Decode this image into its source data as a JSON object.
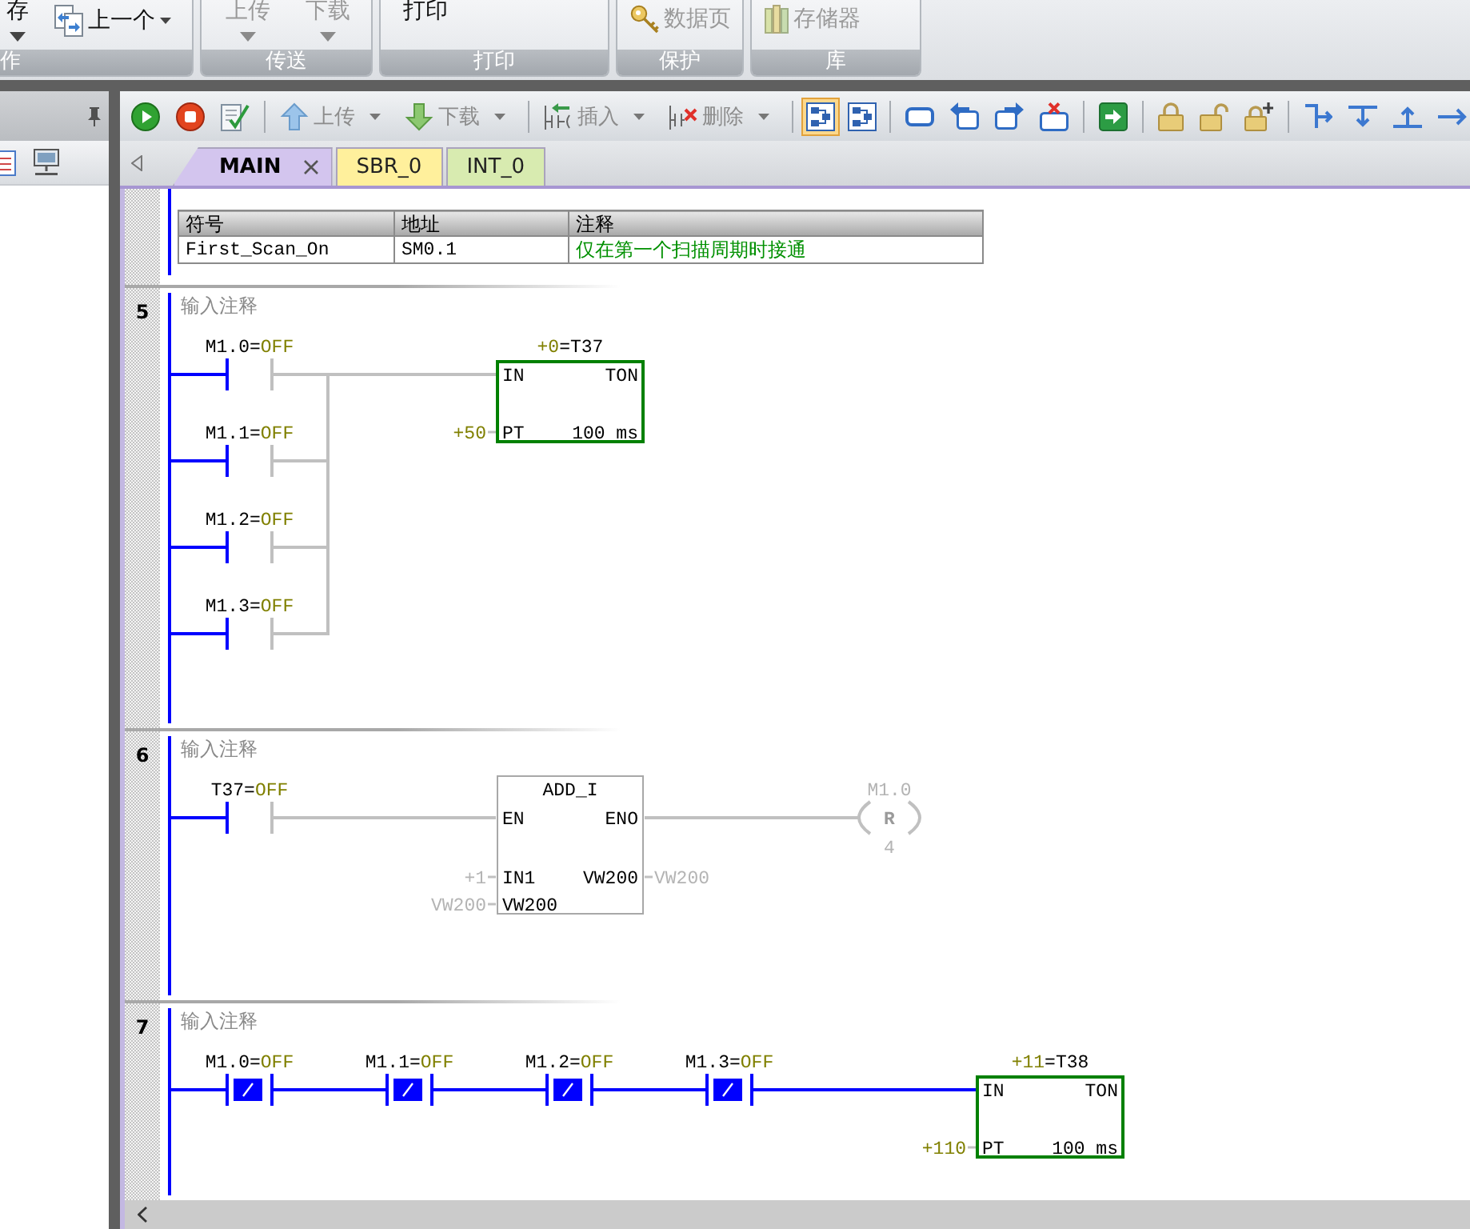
{
  "ribbon": {
    "groups": [
      {
        "label": "作",
        "buttons": [
          {
            "label": "存",
            "kind": "dropdown",
            "disabled": false
          },
          {
            "label": "上一个",
            "kind": "iconmenu",
            "disabled": false
          }
        ]
      },
      {
        "label": "传送",
        "buttons": [
          {
            "label": "上传",
            "kind": "dropdown",
            "disabled": true
          },
          {
            "label": "下载",
            "kind": "dropdown",
            "disabled": true
          }
        ]
      },
      {
        "label": "打印",
        "buttons": [
          {
            "label": "打印",
            "kind": "text",
            "disabled": false
          }
        ]
      },
      {
        "label": "保护",
        "buttons": [
          {
            "label": "数据页",
            "kind": "icon",
            "disabled": true
          }
        ]
      },
      {
        "label": "库",
        "buttons": [
          {
            "label": "存储器",
            "kind": "icon",
            "disabled": true
          }
        ]
      }
    ]
  },
  "toolbar": {
    "buttons": [
      {
        "label": "上传",
        "disabled": true
      },
      {
        "label": "下载",
        "disabled": true
      },
      {
        "label": "插入",
        "disabled": true
      },
      {
        "label": "删除",
        "disabled": true
      }
    ],
    "view_toggles": [
      {
        "selected": true
      },
      {
        "selected": false
      }
    ]
  },
  "tabs": [
    {
      "label": "MAIN",
      "selected": true,
      "color": "#d3c5ee"
    },
    {
      "label": "SBR_0",
      "selected": false,
      "color": "#fff09c"
    },
    {
      "label": "INT_0",
      "selected": false,
      "color": "#d8ebb0"
    }
  ],
  "symbol_table": {
    "columns": [
      "符号",
      "地址",
      "注释"
    ],
    "rows": [
      [
        "First_Scan_On",
        "SM0.1",
        "仅在第一个扫描周期时接通"
      ]
    ]
  },
  "networks": [
    {
      "number": "5",
      "comment": "输入注释",
      "branches": [
        {
          "label": "M1.0=",
          "value": "OFF",
          "kind": "no",
          "closed": false
        },
        {
          "label": "M1.1=",
          "value": "OFF",
          "kind": "no",
          "closed": false
        },
        {
          "label": "M1.2=",
          "value": "OFF",
          "kind": "no",
          "closed": false
        },
        {
          "label": "M1.3=",
          "value": "OFF",
          "kind": "no",
          "closed": false
        }
      ],
      "box": {
        "kind": "timer",
        "active": true,
        "top_value": "+0",
        "top_name": "=T37",
        "rows": [
          {
            "left": "IN",
            "right": "TON"
          },
          {
            "left": "PT",
            "right": "100 ms",
            "input": "+50"
          }
        ]
      }
    },
    {
      "number": "6",
      "comment": "输入注释",
      "contacts": [
        {
          "label": "T37=",
          "value": "OFF",
          "kind": "no",
          "closed": false
        }
      ],
      "box": {
        "kind": "math",
        "active": false,
        "title": "ADD_I",
        "rows": [
          {
            "left": "EN",
            "right": "ENO"
          },
          {
            "left": "IN1",
            "right": "VW200",
            "input": "+1",
            "output": "VW200"
          },
          {
            "left": "VW200",
            "input": "VW200"
          }
        ]
      },
      "coil": {
        "address": "M1.0",
        "type": "R",
        "count": "4",
        "active": false
      }
    },
    {
      "number": "7",
      "comment": "输入注释",
      "contacts": [
        {
          "label": "M1.0=",
          "value": "OFF",
          "kind": "nc",
          "closed": true
        },
        {
          "label": "M1.1=",
          "value": "OFF",
          "kind": "nc",
          "closed": true
        },
        {
          "label": "M1.2=",
          "value": "OFF",
          "kind": "nc",
          "closed": true
        },
        {
          "label": "M1.3=",
          "value": "OFF",
          "kind": "nc",
          "closed": true
        }
      ],
      "box": {
        "kind": "timer",
        "active": true,
        "top_value": "+11",
        "top_name": "=T38",
        "rows": [
          {
            "left": "IN",
            "right": "TON"
          },
          {
            "left": "PT",
            "right": "100 ms",
            "input": "+110"
          }
        ]
      }
    }
  ]
}
